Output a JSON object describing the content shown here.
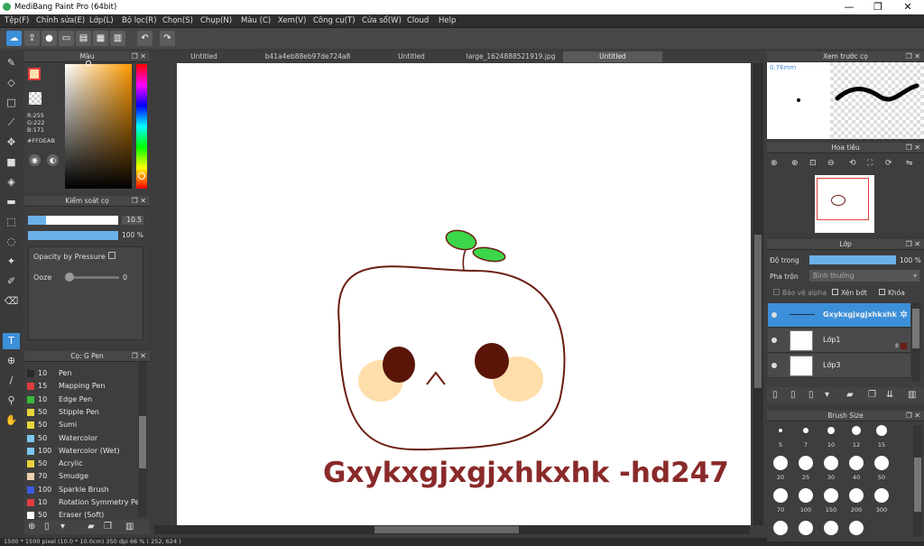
{
  "window": {
    "title": "MediBang Paint Pro (64bit)",
    "controls": [
      "—",
      "❐",
      "✕"
    ]
  },
  "menu": [
    "Tệp(F)",
    "Chỉnh sửa(E)",
    "Lớp(L)",
    "Bộ lọc(R)",
    "Chọn(S)",
    "Chụp(N)",
    "Màu (C)",
    "Xem(V)",
    "Công cụ(T)",
    "Cửa sổ(W)",
    "Cloud",
    "Help"
  ],
  "color_panel": {
    "title": "Màu",
    "r": "R:255",
    "g": "G:222",
    "b": "B:171",
    "hex": "#FFDEAB",
    "fg_color": "#ffdeab"
  },
  "brush_control": {
    "title": "Kiểm soát cọ",
    "size": "10.5",
    "opacity": "100 %",
    "pressure_label": "Opacity by Pressure",
    "ooze_label": "Ooze",
    "ooze_value": "0"
  },
  "brush_list": {
    "title": "Cọ: G Pen",
    "items": [
      {
        "num": "10",
        "name": "Pen",
        "color": "#2a2a2a"
      },
      {
        "num": "15",
        "name": "Mapping Pen",
        "color": "#e03c3c"
      },
      {
        "num": "10",
        "name": "Edge Pen",
        "color": "#3cb93c"
      },
      {
        "num": "50",
        "name": "Stipple Pen",
        "color": "#e8d43a"
      },
      {
        "num": "50",
        "name": "Sumi",
        "color": "#e8d43a"
      },
      {
        "num": "50",
        "name": "Watercolor",
        "color": "#7ec8f0"
      },
      {
        "num": "100",
        "name": "Watercolor (Wet)",
        "color": "#7ec8f0"
      },
      {
        "num": "50",
        "name": "Acrylic",
        "color": "#e8d43a"
      },
      {
        "num": "70",
        "name": "Smudge",
        "color": "#f0d0b0"
      },
      {
        "num": "100",
        "name": "Sparkle Brush",
        "color": "#3c5ae0"
      },
      {
        "num": "10",
        "name": "Rotation Symmetry Pe",
        "color": "#e03c3c"
      },
      {
        "num": "50",
        "name": "Eraser (Soft)",
        "color": "#ffffff"
      }
    ]
  },
  "tabs": [
    "Untitled",
    "b41a4eb88eb97de724a8 (1).jpg",
    "Untitled",
    "large_1624888521919.jpg",
    "Untitled"
  ],
  "canvas": {
    "text": "Gxykxgjxgjxhkxhk -hd247",
    "text_color": "#8a2a2a"
  },
  "preview": {
    "title": "Xem trước cọ",
    "size_label": "0.76mm"
  },
  "navigator": {
    "title": "Hoa tiêu"
  },
  "layers": {
    "title": "Lớp",
    "opacity_label": "Độ trong",
    "opacity_value": "100 %",
    "blend_label": "Pha trộn",
    "blend_value": "Bình thường",
    "protect_alpha": "Bảo vệ alpha",
    "clip": "Xén bớt",
    "lock": "Khóa",
    "items": [
      {
        "name": "Gxykxgjxgjxhkxhk",
        "active": true
      },
      {
        "name": "Lớp1",
        "active": false
      },
      {
        "name": "Lớp3",
        "active": false
      }
    ]
  },
  "brush_size": {
    "title": "Brush Size",
    "labels": [
      "5",
      "7",
      "10",
      "12",
      "15",
      "20",
      "25",
      "30",
      "40",
      "50",
      "70",
      "100",
      "150",
      "200",
      "300"
    ]
  },
  "status": "1500 * 1500 pixel   (10.0 * 10.0cm)   350 dpi   66 %   ( 252, 624 )"
}
